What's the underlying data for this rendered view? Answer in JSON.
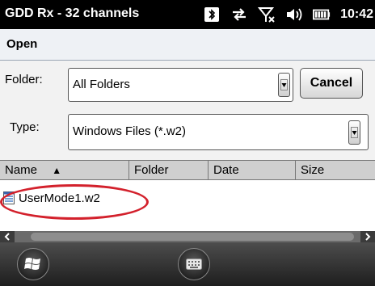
{
  "titlebar": {
    "title": "GDD Rx - 32 channels",
    "icons": [
      "bluetooth-icon",
      "data-connection-icon",
      "signal-off-icon",
      "volume-icon",
      "battery-icon"
    ],
    "time": "10:42"
  },
  "dialog": {
    "title": "Open",
    "folder_label": "Folder:",
    "folder_value": "All Folders",
    "type_label": "Type:",
    "type_value": "Windows Files (*.w2)",
    "cancel_label": "Cancel"
  },
  "list": {
    "columns": [
      {
        "label": "Name",
        "sort": "ascending"
      },
      {
        "label": "Folder"
      },
      {
        "label": "Date"
      },
      {
        "label": "Size"
      }
    ],
    "sort_indicator": "▲",
    "files": [
      {
        "name": "UserMode1.w2",
        "icon": "file-icon"
      }
    ]
  },
  "colors": {
    "highlight": "#d3212c",
    "titlebar": "#000000",
    "header_bg": "#eef1f5"
  }
}
